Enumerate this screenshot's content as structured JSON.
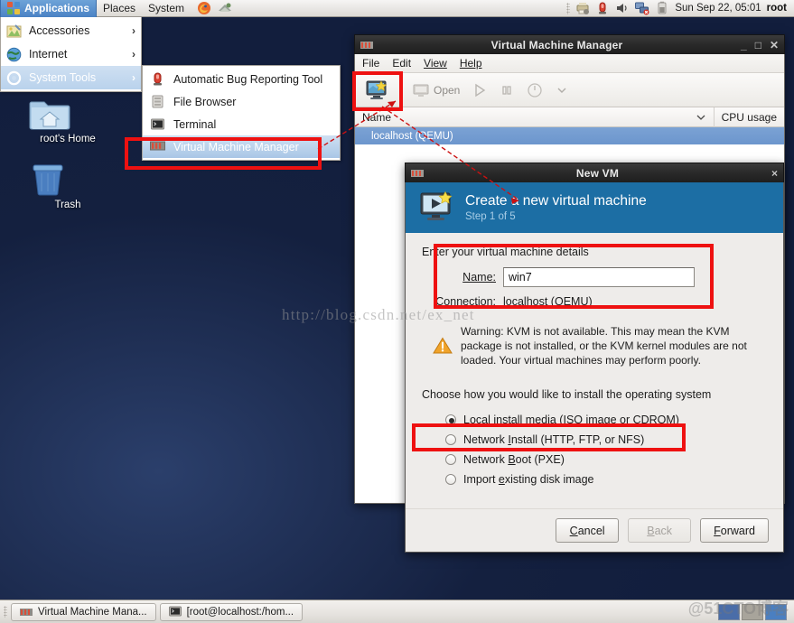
{
  "top_panel": {
    "menus": [
      {
        "label": "Applications",
        "icon": "applications-icon",
        "active": true
      },
      {
        "label": "Places",
        "icon": null,
        "active": false
      },
      {
        "label": "System",
        "icon": null,
        "active": false
      }
    ],
    "launchers": [
      {
        "name": "firefox-icon"
      },
      {
        "name": "evolution-mail-icon"
      }
    ],
    "tray": [
      {
        "name": "printer-settings-icon"
      },
      {
        "name": "bug-alert-icon"
      },
      {
        "name": "volume-icon"
      },
      {
        "name": "network-disconnected-icon"
      },
      {
        "name": "battery-icon"
      }
    ],
    "clock": "Sun Sep 22, 05:01",
    "user": "root"
  },
  "app_menu": {
    "items": [
      {
        "label": "Accessories",
        "icon": "accessories-icon",
        "has_submenu": true,
        "selected": false
      },
      {
        "label": "Internet",
        "icon": "internet-icon",
        "has_submenu": true,
        "selected": false
      },
      {
        "label": "System Tools",
        "icon": "system-tools-icon",
        "has_submenu": true,
        "selected": true
      }
    ]
  },
  "sub_menu": {
    "items": [
      {
        "label": "Automatic Bug Reporting Tool",
        "icon": "abrt-icon",
        "selected": false
      },
      {
        "label": "File Browser",
        "icon": "file-browser-icon",
        "selected": false
      },
      {
        "label": "Terminal",
        "icon": "terminal-icon",
        "selected": false
      },
      {
        "label": "Virtual Machine Manager",
        "icon": "vmm-icon",
        "selected": true
      }
    ]
  },
  "desktop": {
    "icons": [
      {
        "label": "root's Home",
        "icon": "home-folder-icon"
      },
      {
        "label": "Trash",
        "icon": "trash-icon"
      }
    ],
    "watermark_url": "http://blog.csdn.net/ex_net",
    "watermark_brand": "@51CTO博客"
  },
  "vmm_window": {
    "title": "Virtual Machine Manager",
    "titlebar_icon": "vmm-icon",
    "window_controls": [
      "minimize",
      "maximize",
      "close"
    ],
    "menubar": [
      "File",
      "Edit",
      "View",
      "Help"
    ],
    "toolbar": [
      {
        "name": "new-vm-icon",
        "label": ""
      },
      {
        "name": "open-button",
        "label": "Open",
        "disabled": true
      },
      {
        "name": "run-icon",
        "label": "",
        "disabled": true
      },
      {
        "name": "pause-icon",
        "label": "",
        "disabled": true
      },
      {
        "name": "shutdown-icon",
        "label": "",
        "disabled": true
      },
      {
        "name": "chevron-down-icon",
        "label": "",
        "disabled": true
      }
    ],
    "columns": [
      "Name",
      "CPU usage"
    ],
    "rows": [
      {
        "name": "localhost (QEMU)",
        "cpu": "",
        "selected": true
      }
    ]
  },
  "new_vm_dialog": {
    "title": "New VM",
    "titlebar_icon": "vmm-icon",
    "close_label": "×",
    "header": {
      "icon": "create-vm-icon",
      "heading": "Create a new virtual machine",
      "step": "Step 1 of 5"
    },
    "details_label": "Enter your virtual machine details",
    "name_label": "Name:",
    "name_value": "win7",
    "connection_label": "Connection:",
    "connection_value": "localhost (QEMU)",
    "warning_icon": "warning-triangle-icon",
    "warning_text": "Warning: KVM is not available. This may mean the KVM package is not installed, or the KVM kernel modules are not loaded. Your virtual machines may perform poorly.",
    "install_label": "Choose how you would like to install the operating system",
    "install_options": [
      {
        "label": "Local install media (ISO image or CDROM)",
        "selected": true
      },
      {
        "label": "Network Install (HTTP, FTP, or NFS)",
        "selected": false
      },
      {
        "label": "Network Boot (PXE)",
        "selected": false
      },
      {
        "label": "Import existing disk image",
        "selected": false
      }
    ],
    "buttons": [
      {
        "label": "Cancel",
        "name": "cancel-button",
        "disabled": false
      },
      {
        "label": "Back",
        "name": "back-button",
        "disabled": true
      },
      {
        "label": "Forward",
        "name": "forward-button",
        "disabled": false
      }
    ]
  },
  "bottom_panel": {
    "tasks": [
      {
        "label": "Virtual Machine Mana...",
        "icon": "vmm-icon"
      },
      {
        "label": "[root@localhost:/hom...",
        "icon": "terminal-icon"
      }
    ],
    "workspaces": 3
  },
  "annotations": {
    "highlight_color": "#ee1111",
    "boxes": [
      {
        "name": "vmm-menu-item-highlight"
      },
      {
        "name": "new-vm-toolbar-highlight"
      },
      {
        "name": "vm-details-highlight"
      },
      {
        "name": "local-install-media-highlight"
      }
    ],
    "arrow_color": "#cc1111"
  }
}
